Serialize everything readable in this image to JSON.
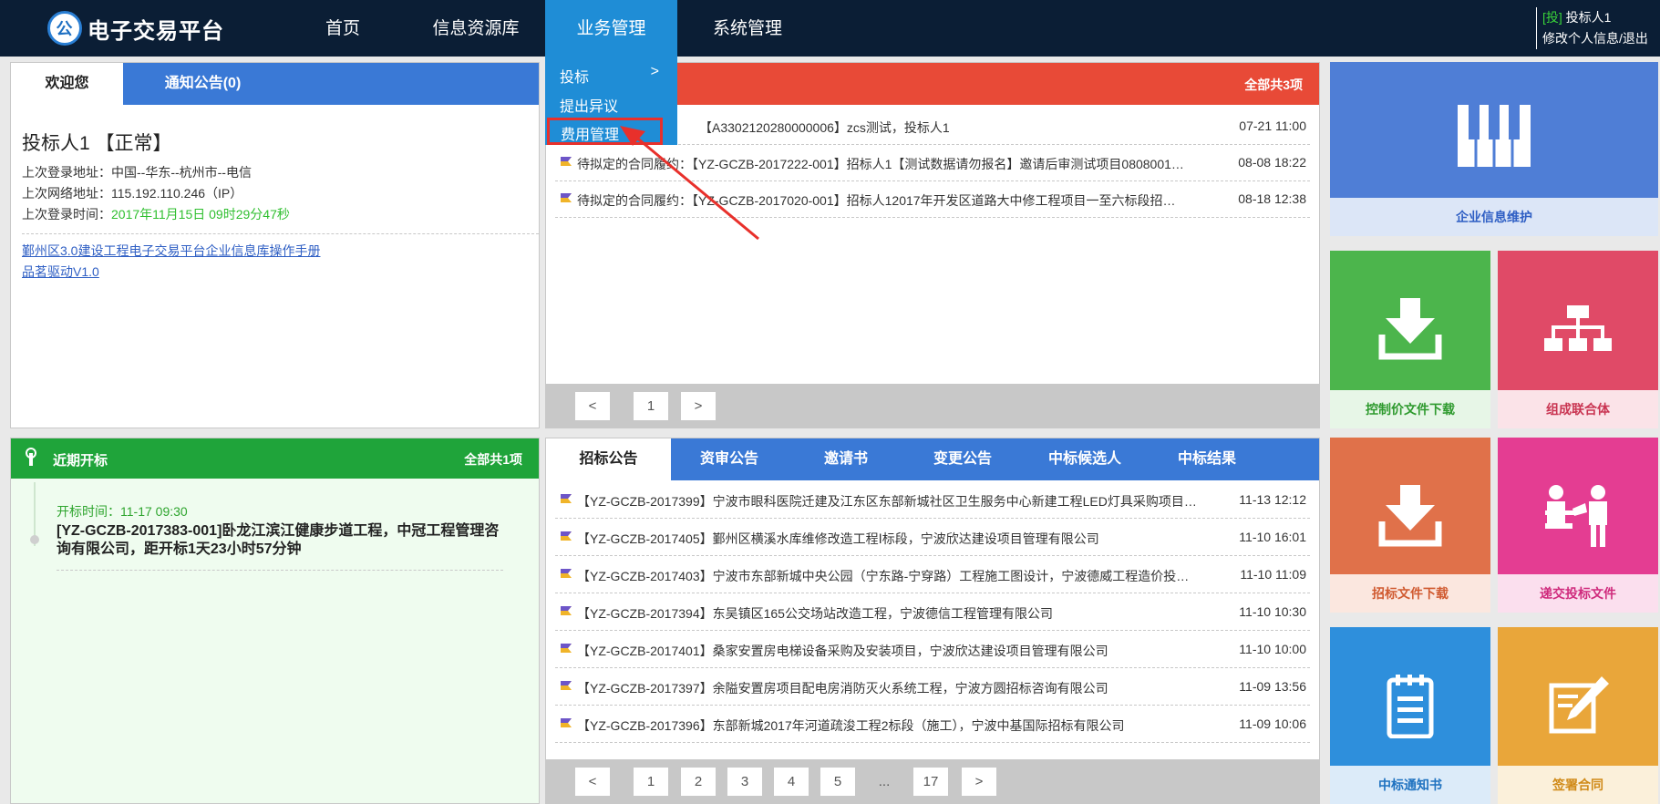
{
  "header": {
    "logo_glyph": "公",
    "app_title": "电子交易平台",
    "nav": [
      "首页",
      "信息资源库",
      "业务管理",
      "系统管理"
    ],
    "user_tag": "[投]",
    "user_name": "投标人1",
    "user_links": "修改个人信息/退出"
  },
  "dropdown": {
    "items": [
      "投标",
      "提出异议",
      "费用管理"
    ],
    "arrow": ">"
  },
  "welcome": {
    "tabs": [
      "欢迎您",
      "通知公告(0)"
    ],
    "name": "投标人1 【正常】",
    "login_addr_label": "上次登录地址：",
    "login_addr": "中国--华东--杭州市--电信",
    "net_addr_label": "上次网络地址：",
    "net_addr": "115.192.110.246（IP）",
    "login_time_label": "上次登录时间：",
    "login_time": "2017年11月15日 09时29分47秒",
    "links": [
      "鄞州区3.0建设工程电子交易平台企业信息库操作手册",
      "品茗驱动V1.0"
    ]
  },
  "todo": {
    "count": "全部共3项",
    "rows": [
      {
        "text": "【A3302120280000006】zcs测试，投标人1",
        "date": "07-21 11:00"
      },
      {
        "text": "待拟定的合同履约：【YZ-GCZB-2017222-001】招标人1【测试数据请勿报名】邀请后审测试项目0808001…",
        "date": "08-08 18:22"
      },
      {
        "text": "待拟定的合同履约：【YZ-GCZB-2017020-001】招标人12017年开发区道路大中修工程项目一至六标段招…",
        "date": "08-18 12:38"
      }
    ],
    "pager": [
      "<",
      "1",
      ">"
    ]
  },
  "tiles": [
    {
      "label": "企业信息维护",
      "icon": "piano-keys-icon"
    },
    {
      "label": "控制价文件下载",
      "icon": "download-icon"
    },
    {
      "label": "组成联合体",
      "icon": "org-chart-icon"
    },
    {
      "label": "招标文件下载",
      "icon": "download-icon"
    },
    {
      "label": "递交投标文件",
      "icon": "handover-icon"
    },
    {
      "label": "中标通知书",
      "icon": "notepad-icon"
    },
    {
      "label": "签署合同",
      "icon": "sign-icon"
    }
  ],
  "opening": {
    "title": "近期开标",
    "count": "全部共1项",
    "time": "开标时间：11-17 09:30",
    "project": "[YZ-GCZB-2017383-001]卧龙江滨江健康步道工程，中冠工程管理咨询有限公司，距开标1天23小时57分钟"
  },
  "notices": {
    "tabs": [
      "招标公告",
      "资审公告",
      "邀请书",
      "变更公告",
      "中标候选人",
      "中标结果"
    ],
    "rows": [
      {
        "text": "【YZ-GCZB-2017399】宁波市眼科医院迁建及江东区东部新城社区卫生服务中心新建工程LED灯具采购项目…",
        "date": "11-13 12:12"
      },
      {
        "text": "【YZ-GCZB-2017405】鄞州区横溪水库维修改造工程Ⅰ标段，宁波欣达建设项目管理有限公司",
        "date": "11-10 16:01"
      },
      {
        "text": "【YZ-GCZB-2017403】宁波市东部新城中央公园（宁东路-宁穿路）工程施工图设计，宁波德威工程造价投…",
        "date": "11-10 11:09"
      },
      {
        "text": "【YZ-GCZB-2017394】东吴镇区165公交场站改造工程，宁波德信工程管理有限公司",
        "date": "11-10 10:30"
      },
      {
        "text": "【YZ-GCZB-2017401】桑家安置房电梯设备采购及安装项目，宁波欣达建设项目管理有限公司",
        "date": "11-10 10:00"
      },
      {
        "text": "【YZ-GCZB-2017397】余隘安置房项目配电房消防灭火系统工程，宁波方圆招标咨询有限公司",
        "date": "11-09 13:56"
      },
      {
        "text": "【YZ-GCZB-2017396】东部新城2017年河道疏浚工程2标段（施工），宁波中基国际招标有限公司",
        "date": "11-09 10:06"
      }
    ],
    "pager": [
      "<",
      "1",
      "2",
      "3",
      "4",
      "5",
      "...",
      "17",
      ">"
    ]
  },
  "colors": {
    "topbar": "#0b1e35",
    "nav_active": "#1f8dd6",
    "blue_tabs": "#3a79d6",
    "red_head": "#e84a37",
    "green_head": "#1fa43a",
    "highlight": "#e8302b"
  }
}
